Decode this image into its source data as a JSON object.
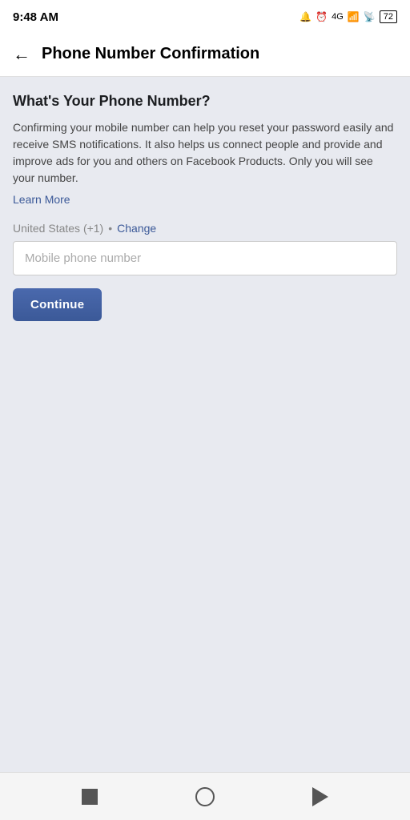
{
  "statusBar": {
    "time": "9:48 AM",
    "battery": "72"
  },
  "navBar": {
    "back_label": "←",
    "title": "Phone Number Confirmation"
  },
  "card": {
    "heading": "What's Your Phone Number?",
    "description": "Confirming your mobile number can help you reset your password easily and receive SMS notifications. It also helps us connect people and provide and improve ads for you and others on Facebook Products. Only you will see your number.",
    "learn_more": "Learn More",
    "country_name": "United States (+1)",
    "dot": "•",
    "change_label": "Change",
    "phone_placeholder": "Mobile phone number",
    "continue_label": "Continue"
  }
}
